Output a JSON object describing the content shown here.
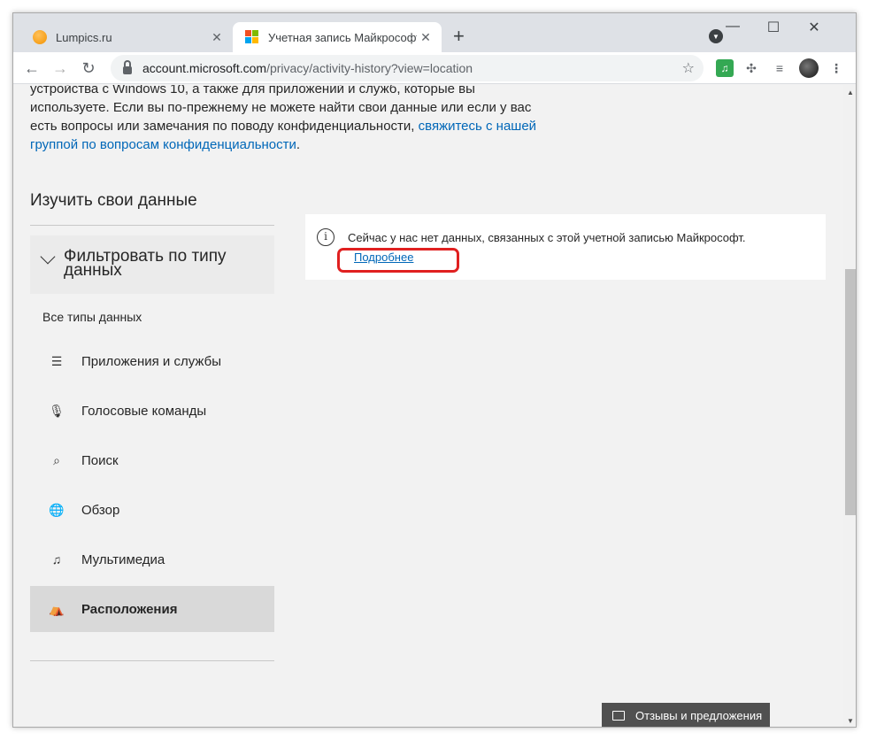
{
  "browser": {
    "tabs": [
      {
        "title": "Lumpics.ru",
        "active": false
      },
      {
        "title": "Учетная запись Майкрософт | М",
        "active": true
      }
    ],
    "url_host": "account.microsoft.com",
    "url_path": "/privacy/activity-history?view=location",
    "window_controls": [
      "minimize-icon",
      "maximize-icon",
      "close-icon"
    ]
  },
  "page": {
    "intro_line1": "устройства с Windows 10, а также для приложений и служб, которые вы",
    "intro_line2": "используете. Если вы по-прежнему не можете найти свои данные или если у вас",
    "intro_line3": "есть вопросы или замечания по поводу конфиденциальности,",
    "intro_link": "свяжитесь с нашей группой по вопросам конфиденциальности",
    "intro_end": ".",
    "explore_title": "Изучить свои данные",
    "filter_title": "Фильтровать по типу данных",
    "all_types": "Все типы данных",
    "filters": [
      {
        "label": "Приложения и службы",
        "icon": "list-icon"
      },
      {
        "label": "Голосовые команды",
        "icon": "microphone-icon"
      },
      {
        "label": "Поиск",
        "icon": "search-icon"
      },
      {
        "label": "Обзор",
        "icon": "globe-icon"
      },
      {
        "label": "Мультимедиа",
        "icon": "media-icon"
      },
      {
        "label": "Расположения",
        "icon": "location-icon",
        "active": true
      }
    ],
    "info_message": "Сейчас у нас нет данных, связанных с этой учетной записью Майкрософт.",
    "info_link": "Подробнее",
    "feedback_label": "Отзывы и предложения"
  },
  "colors": {
    "link": "#0067b8",
    "highlight": "#e02020",
    "active_filter": "#d9d9d9"
  }
}
